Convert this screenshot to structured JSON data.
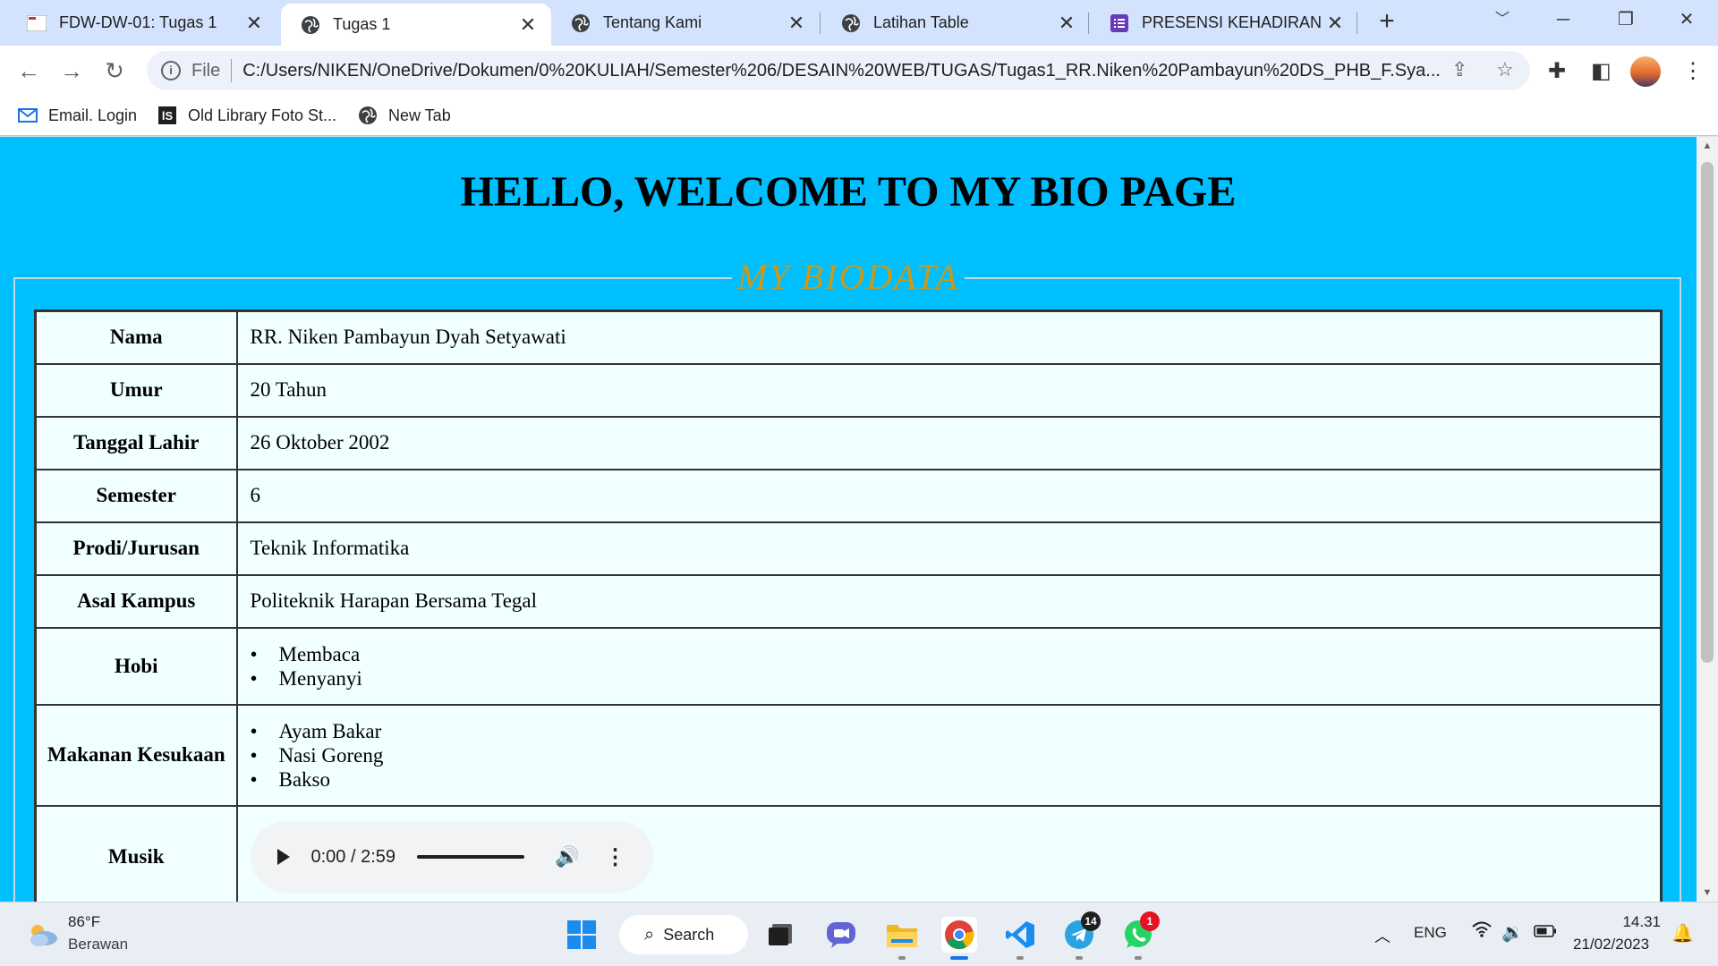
{
  "browser": {
    "tabs": [
      {
        "title": "FDW-DW-01: Tugas 1",
        "icon": "site-icon"
      },
      {
        "title": "Tugas 1",
        "icon": "globe-icon",
        "active": true
      },
      {
        "title": "Tentang Kami",
        "icon": "globe-icon"
      },
      {
        "title": "Latihan Table",
        "icon": "globe-icon"
      },
      {
        "title": "PRESENSI KEHADIRAN",
        "icon": "forms-icon"
      }
    ],
    "omnibox": {
      "scheme": "File",
      "url": "C:/Users/NIKEN/OneDrive/Dokumen/0%20KULIAH/Semester%206/DESAIN%20WEB/TUGAS/Tugas1_RR.Niken%20Pambayun%20DS_PHB_F.Sya..."
    },
    "bookmarks": [
      {
        "label": "Email. Login",
        "icon": "mail-icon"
      },
      {
        "label": "Old Library Foto St...",
        "icon": "library-icon"
      },
      {
        "label": "New Tab",
        "icon": "globe-icon"
      }
    ]
  },
  "page": {
    "heading": "HELLO, WELCOME TO MY BIO PAGE",
    "legend": "MY BIODATA",
    "rows": [
      {
        "label": "Nama",
        "value": "RR. Niken Pambayun Dyah Setyawati"
      },
      {
        "label": "Umur",
        "value": "20 Tahun"
      },
      {
        "label": "Tanggal Lahir",
        "value": "26 Oktober 2002"
      },
      {
        "label": "Semester",
        "value": "6"
      },
      {
        "label": "Prodi/Jurusan",
        "value": "Teknik Informatika"
      },
      {
        "label": "Asal Kampus",
        "value": "Politeknik Harapan Bersama Tegal"
      },
      {
        "label": "Hobi",
        "items": [
          "Membaca",
          "Menyanyi"
        ]
      },
      {
        "label": "Makanan Kesukaan",
        "items": [
          "Ayam Bakar",
          "Nasi Goreng",
          "Bakso"
        ]
      },
      {
        "label": "Musik",
        "audio_time": "0:00 / 2:59"
      }
    ],
    "colors": {
      "background": "#00bfff",
      "legend": "#c79a1b",
      "table_bg": "#f0ffff"
    }
  },
  "taskbar": {
    "weather": {
      "temp": "86°F",
      "desc": "Berawan"
    },
    "search_label": "Search",
    "telegram_badge": "14",
    "whatsapp_badge": "1",
    "language": "ENG",
    "time": "14.31",
    "date": "21/02/2023"
  }
}
